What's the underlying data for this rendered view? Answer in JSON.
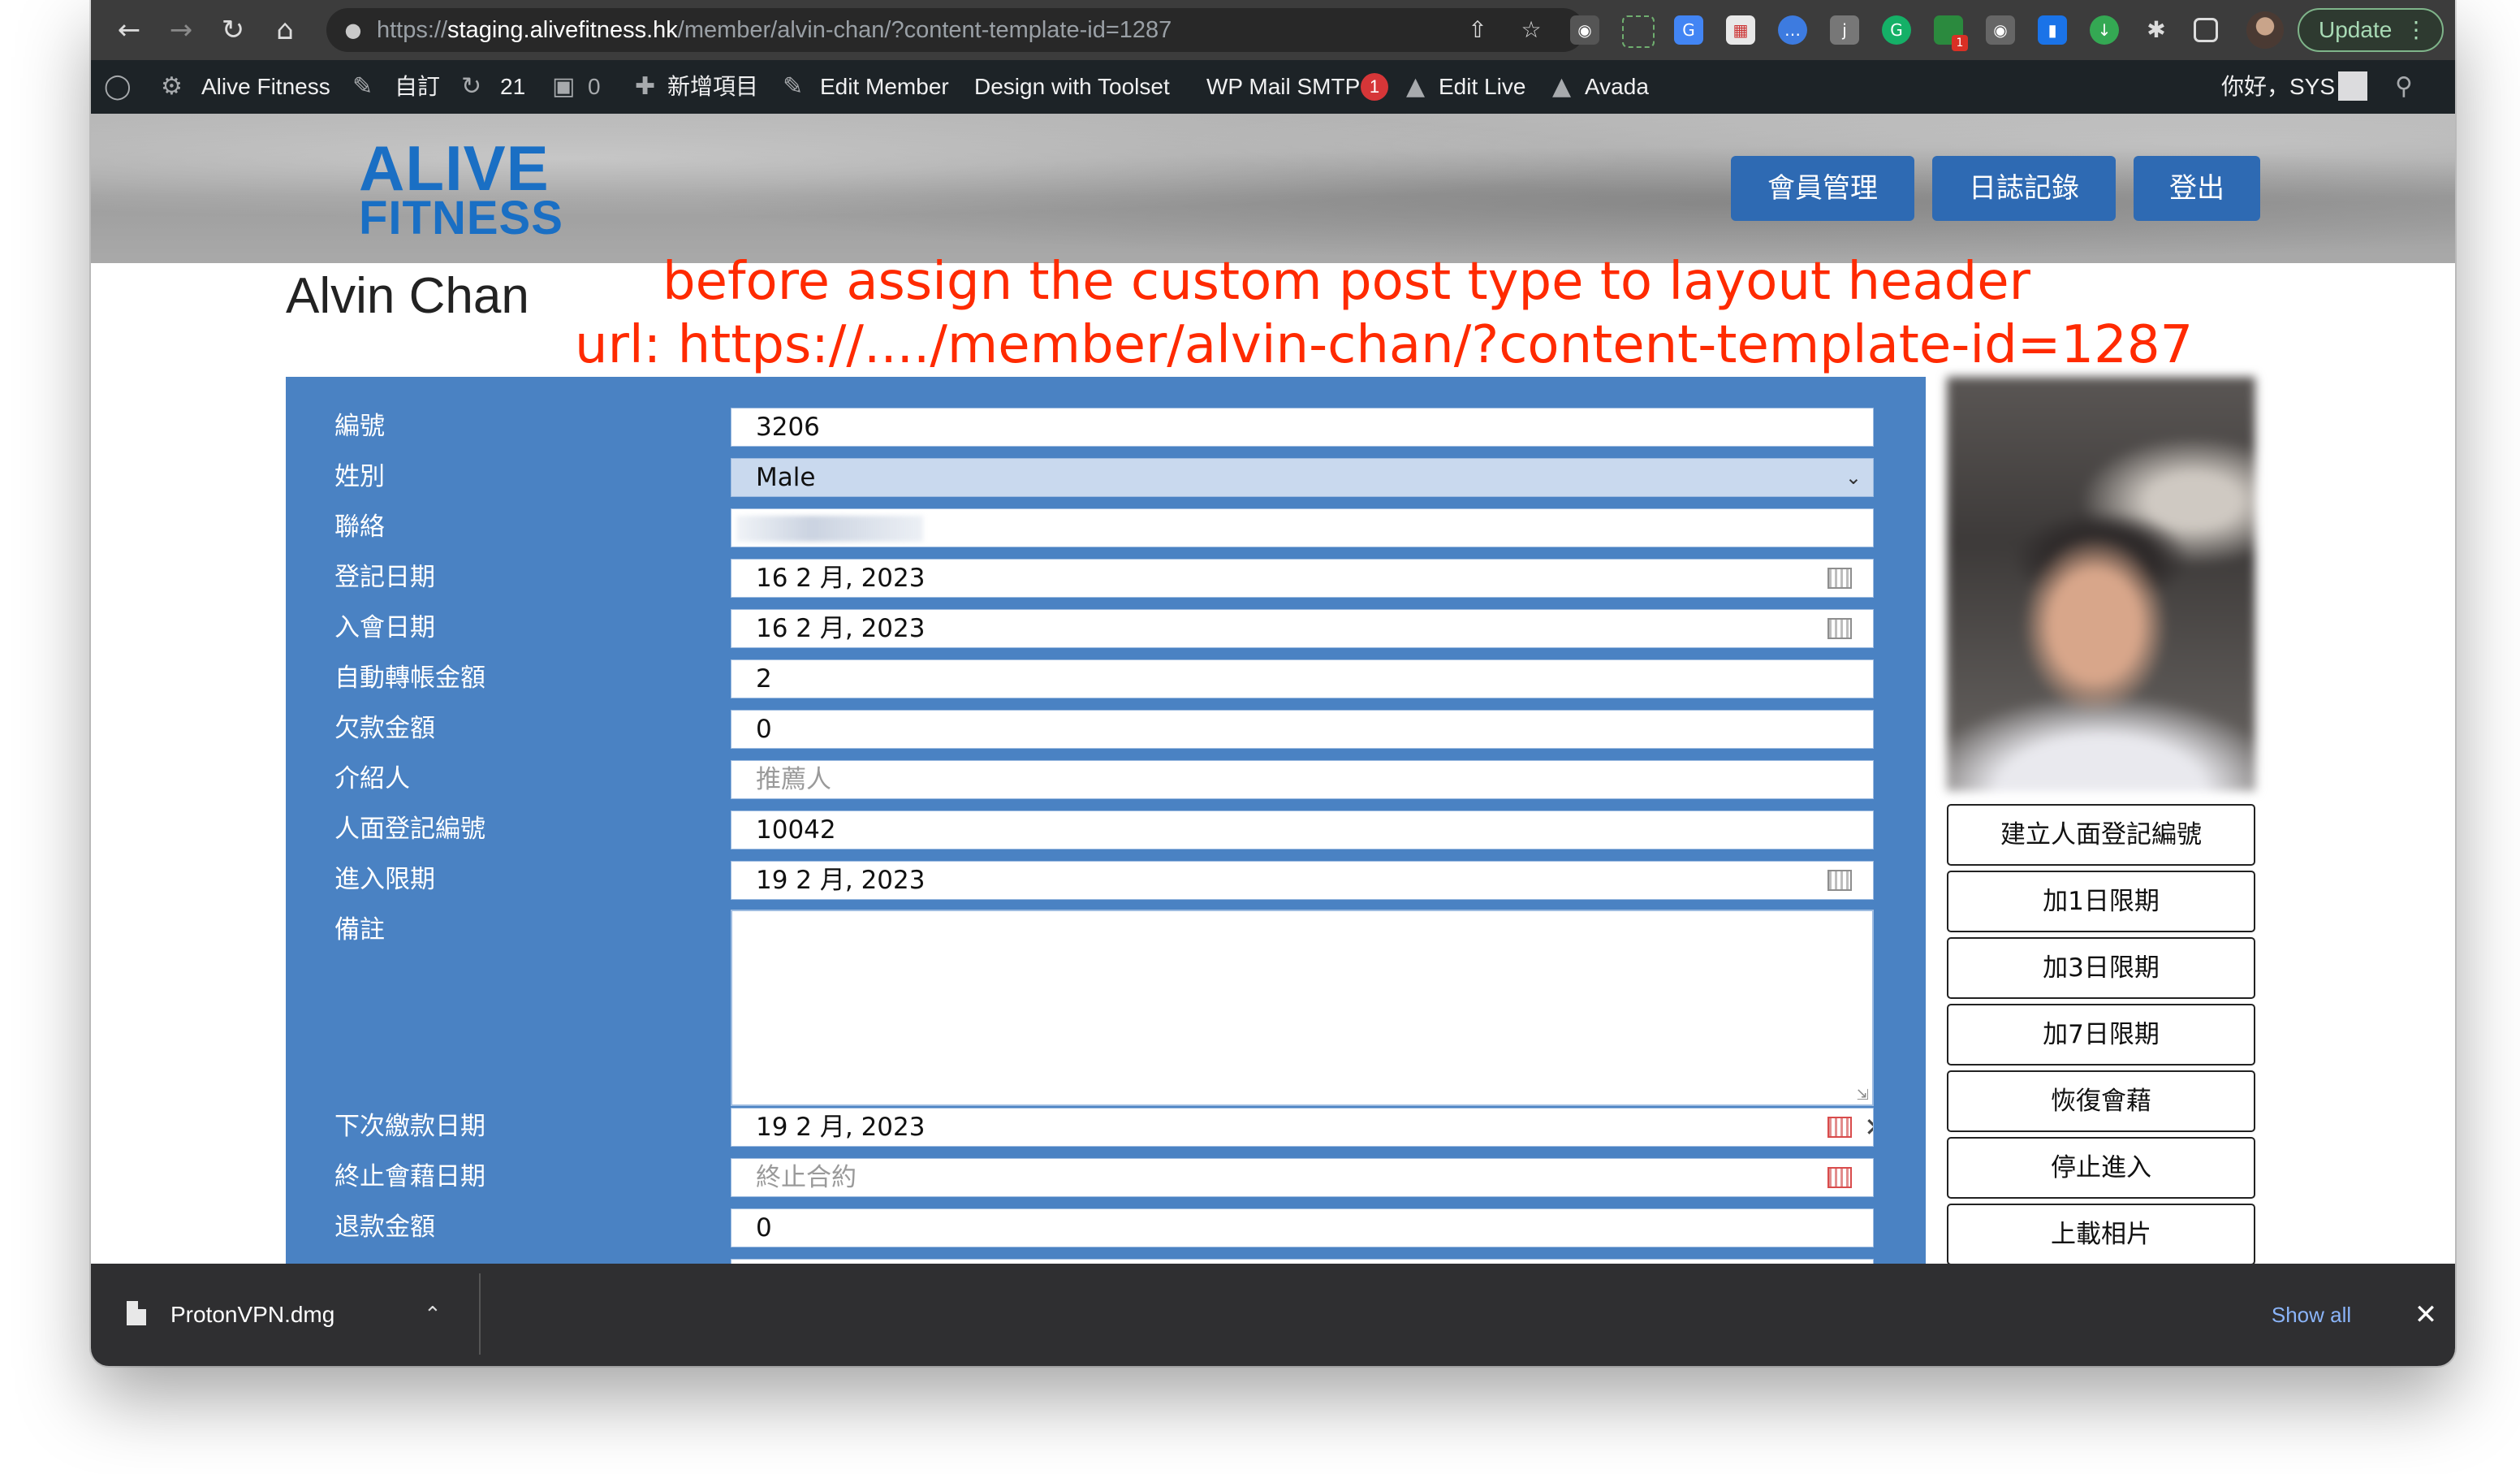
{
  "browser": {
    "url_scheme": "https://",
    "url_host": "staging.alivefitness.hk",
    "url_path": "/member/alvin-chan/?content-template-id=1287",
    "update_label": "Update",
    "extension_badge": "1"
  },
  "adminbar": {
    "site_name": "Alive Fitness",
    "customize": "自訂",
    "updates_count": "21",
    "comments_count": "0",
    "new_item": "新增項目",
    "edit_member": "Edit Member",
    "design_toolset": "Design with Toolset",
    "wp_mail_smtp": "WP Mail SMTP",
    "wp_mail_badge": "1",
    "edit_live": "Edit Live",
    "avada": "Avada",
    "greeting": "你好，SYS"
  },
  "header": {
    "logo_line1": "ALIVE",
    "logo_line2": "FITNESS",
    "nav": [
      "會員管理",
      "日誌記錄",
      "登出"
    ]
  },
  "page": {
    "member_name": "Alvin Chan",
    "annotation_line1": "before assign the custom post type to layout header",
    "annotation_line2": "url: https://..../member/alvin-chan/?content-template-id=1287"
  },
  "form": {
    "fields": [
      {
        "label": "編號",
        "value": "3206"
      },
      {
        "label": "姓別",
        "value": "Male"
      },
      {
        "label": "聯絡",
        "value": ""
      },
      {
        "label": "登記日期",
        "value": "16 2 月, 2023"
      },
      {
        "label": "入會日期",
        "value": "16 2 月, 2023"
      },
      {
        "label": "自動轉帳金額",
        "value": "2"
      },
      {
        "label": "欠款金額",
        "value": "0"
      },
      {
        "label": "介紹人",
        "placeholder": "推薦人"
      },
      {
        "label": "人面登記編號",
        "value": "10042"
      },
      {
        "label": "進入限期",
        "value": "19 2 月, 2023"
      },
      {
        "label": "備註",
        "value": ""
      },
      {
        "label": "下次繳款日期",
        "value": "19 2 月, 2023"
      },
      {
        "label": "終止會藉日期",
        "placeholder": "終止合約"
      },
      {
        "label": "退款金額",
        "value": "0"
      }
    ]
  },
  "side_buttons": [
    "建立人面登記編號",
    "加1日限期",
    "加3日限期",
    "加7日限期",
    "恢復會藉",
    "停止進入",
    "上載相片"
  ],
  "downloads": {
    "file_name": "ProtonVPN.dmg",
    "show_all": "Show all"
  },
  "colors": {
    "form_panel": "#4a82c3",
    "header_button": "#2e6ab3",
    "annotation": "#ff2a00",
    "logo": "#1a6fc4"
  }
}
